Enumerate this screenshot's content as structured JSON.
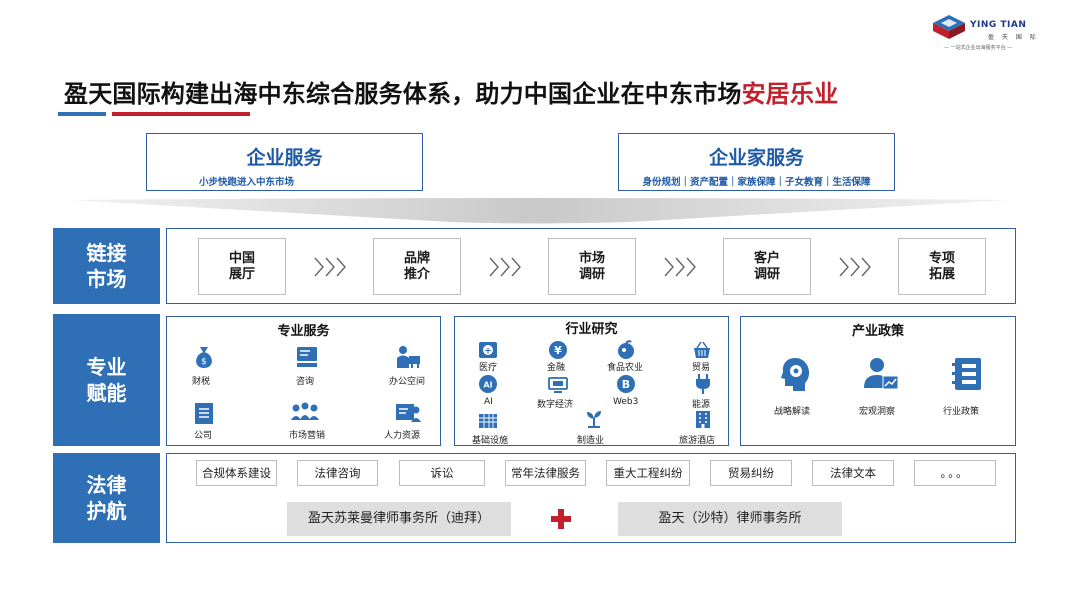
{
  "brand": {
    "name": "YING TIAN",
    "name_cn": "盈 天 国 际",
    "slogan": "— 一站式企业出海服务平台 —"
  },
  "title": {
    "main": "盈天国际构建出海中东综合服务体系，助力中国企业在中东市场",
    "highlight": "安居乐业"
  },
  "top": {
    "left": {
      "title": "企业服务",
      "subtitle": "小步快跑进入中东市场"
    },
    "right": {
      "title": "企业家服务",
      "subtitle": "身份规划｜资产配置｜家族保障｜子女教育｜生活保障"
    }
  },
  "row1": {
    "side": [
      "链接",
      "市场"
    ],
    "steps": [
      {
        "line1": "中国",
        "line2": "展厅"
      },
      {
        "line1": "品牌",
        "line2": "推介"
      },
      {
        "line1": "市场",
        "line2": "调研"
      },
      {
        "line1": "客户",
        "line2": "调研"
      },
      {
        "line1": "专项",
        "line2": "拓展"
      }
    ]
  },
  "row2": {
    "side": [
      "专业",
      "赋能"
    ],
    "professional": {
      "title": "专业服务",
      "items": [
        "财税",
        "咨询",
        "办公空间",
        "公司",
        "市场营销",
        "人力资源"
      ]
    },
    "industry": {
      "title": "行业研究",
      "items": [
        "医疗",
        "金融",
        "食品农业",
        "贸易",
        "AI",
        "数字经济",
        "Web3",
        "能源",
        "基础设施",
        "制造业",
        "旅游酒店"
      ],
      "ai_badge": "AI",
      "medical_badge": "+",
      "finance_badge": "¥",
      "web3_badge": "B"
    },
    "policy": {
      "title": "产业政策",
      "items": [
        "战略解读",
        "宏观洞察",
        "行业政策"
      ]
    }
  },
  "row3": {
    "side": [
      "法律",
      "护航"
    ],
    "tags": [
      "合规体系建设",
      "法律咨询",
      "诉讼",
      "常年法律服务",
      "重大工程纠纷",
      "贸易纠纷",
      "法律文本",
      "。。。"
    ],
    "firm_left": "盈天苏莱曼律师事务所（迪拜）",
    "firm_right": "盈天（沙特）律师事务所"
  },
  "colors": {
    "primary": "#2e6fb5",
    "accent": "#c3202d"
  }
}
